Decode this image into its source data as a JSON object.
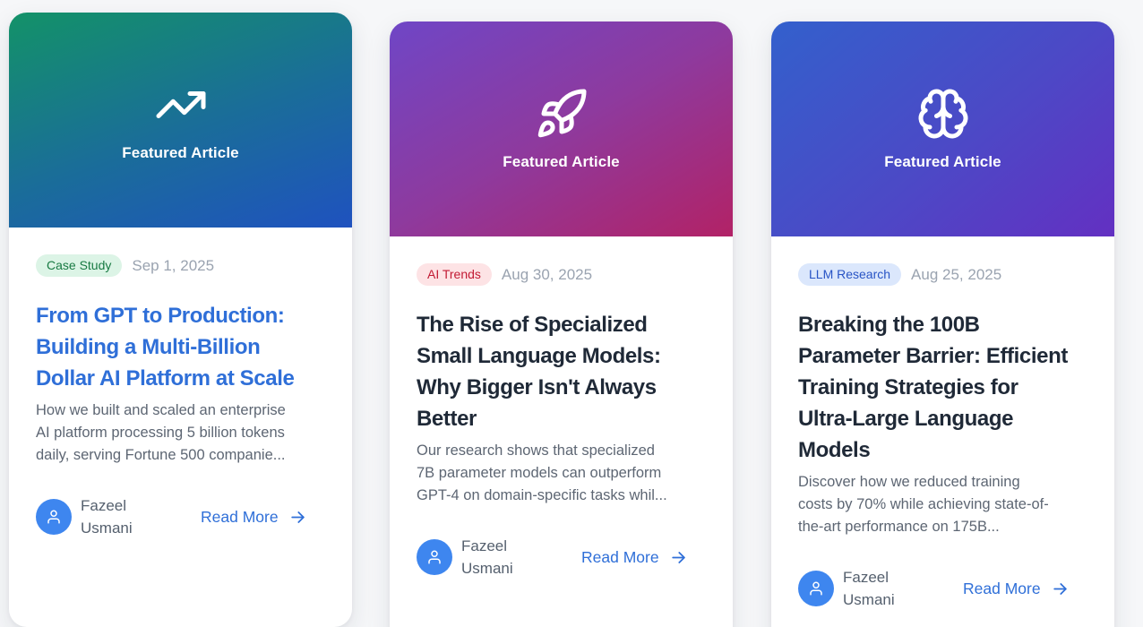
{
  "cards": [
    {
      "hero_label": "Featured Article",
      "hero_icon": "trending-up-icon",
      "category": "Case Study",
      "date": "Sep 1, 2025",
      "title_lines": [
        "From GPT to Production:",
        "Building a Multi-Billion",
        "Dollar AI Platform at Scale"
      ],
      "excerpt_lines": [
        "How we built and scaled an enterprise",
        "AI platform processing 5 billion tokens",
        "daily, serving Fortune 500 companie..."
      ],
      "author_lines": [
        "Fazeel",
        "Usmani"
      ],
      "read_more": "Read More"
    },
    {
      "hero_label": "Featured Article",
      "hero_icon": "rocket-icon",
      "category": "AI Trends",
      "date": "Aug 30, 2025",
      "title_lines": [
        "The Rise of Specialized",
        "Small Language Models:",
        "Why Bigger Isn't Always",
        "Better"
      ],
      "excerpt_lines": [
        "Our research shows that specialized",
        "7B parameter models can outperform",
        "GPT-4 on domain-specific tasks whil..."
      ],
      "author_lines": [
        "Fazeel",
        "Usmani"
      ],
      "read_more": "Read More"
    },
    {
      "hero_label": "Featured Article",
      "hero_icon": "brain-icon",
      "category": "LLM Research",
      "date": "Aug 25, 2025",
      "title_lines": [
        "Breaking the 100B",
        "Parameter Barrier: Efficient",
        "Training Strategies for",
        "Ultra-Large Language",
        "Models"
      ],
      "excerpt_lines": [
        "Discover how we reduced training",
        "costs by 70% while achieving state-of-",
        "the-art performance on 175B..."
      ],
      "author_lines": [
        "Fazeel",
        "Usmani"
      ],
      "read_more": "Read More"
    }
  ],
  "colors": {
    "accent": "#2f6fd8",
    "avatar": "#3e86ef"
  }
}
